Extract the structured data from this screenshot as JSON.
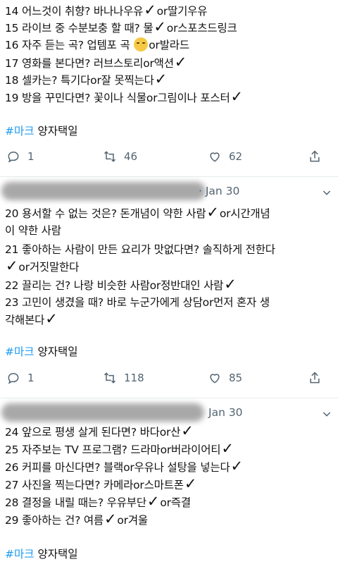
{
  "tweet1": {
    "q14": {
      "pre": "14 어느것이 취향? 바나나우유",
      "post": "or딸기우유"
    },
    "q15": {
      "pre": "15 라이브 중 수분보충 할 때? 물",
      "post": "or스포츠드링크"
    },
    "q16": {
      "pre": "16 자주 듣는 곡? 업템포 곡",
      "post": "or발라드"
    },
    "q17": {
      "pre": "17 영화를 본다면? 러브스토리or액션"
    },
    "q18": {
      "pre": "18 셀카는? 특기다or잘 못찍는다"
    },
    "q19": {
      "pre": "19 방을 꾸민다면? 꽃이나 식물or그림이나 포스터"
    },
    "hashtag": "#마크",
    "hashtag_rest": " 양자택일",
    "replies": "1",
    "retweets": "46",
    "likes": "62"
  },
  "tweet2": {
    "date": "· Jan 30",
    "q20a": {
      "pre": "20 용서할 수 없는 것은? 돈개념이 약한 사람",
      "post": "or시간개념"
    },
    "q20b": "이 약한 사람",
    "q21a": "21 좋아하는 사람이 만든 요리가 맛없다면? 솔직하게 전한다",
    "q21b": {
      "post": "or거짓말한다"
    },
    "q22": {
      "pre": "22 끌리는 건? 나랑 비슷한 사람or정반대인 사람"
    },
    "q23a": "23 고민이 생겼을 때? 바로 누군가에게 상담or먼저 혼자 생",
    "q23b": {
      "pre": "각해본다"
    },
    "hashtag": "#마크",
    "hashtag_rest": " 양자택일",
    "replies": "1",
    "retweets": "118",
    "likes": "85"
  },
  "tweet3": {
    "date": "Jan 30",
    "q24": {
      "pre": "24 앞으로 평생 살게 된다면? 바다or산"
    },
    "q25": {
      "pre": "25 자주보는 TV 프로그램? 드라마or버라이어티"
    },
    "q26": {
      "pre": "26 커피를 마신다면? 블랙or우유나 설탕을 넣는다"
    },
    "q27": {
      "pre": "27 사진을 찍는다면? 카메라or스마트폰"
    },
    "q28": {
      "pre": "28 결정을 내릴 때는? 우유부단",
      "post": "or즉결"
    },
    "q29": {
      "pre": "29 좋아하는 건? 여름",
      "post": "or겨울"
    },
    "hashtag": "#마크",
    "hashtag_rest": " 양자택일"
  },
  "icons": {
    "check": "✓",
    "reply": "reply-icon",
    "retweet": "retweet-icon",
    "like": "heart-icon",
    "share": "share-icon",
    "more": "chevron-down-icon"
  },
  "colors": {
    "link": "#1d9bf0",
    "muted": "#536471"
  }
}
